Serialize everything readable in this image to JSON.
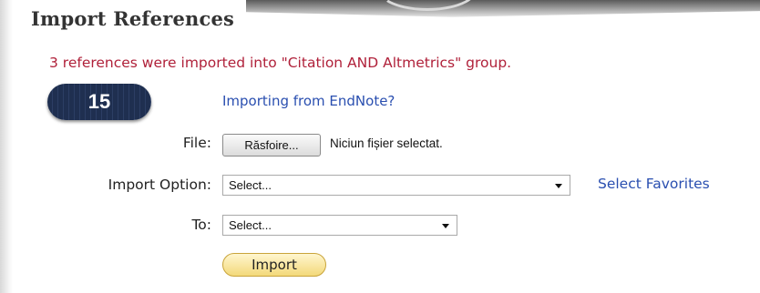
{
  "page": {
    "title": "Import References",
    "message": "3 references were imported into \"Citation AND Altmetrics\" group.",
    "step_badge": "15",
    "endnote_link": "Importing from EndNote?"
  },
  "form": {
    "file_label": "File:",
    "browse_label": "Răsfoire...",
    "file_status": "Niciun fișier selectat.",
    "import_option_label": "Import Option:",
    "import_option_value": "Select...",
    "select_favorites": "Select Favorites",
    "to_label": "To:",
    "to_value": "Select...",
    "import_label": "Import"
  },
  "colors": {
    "message": "#b0213a",
    "link": "#2a4fb0",
    "badge": "#22345a",
    "import_button": "#f3d97a"
  }
}
